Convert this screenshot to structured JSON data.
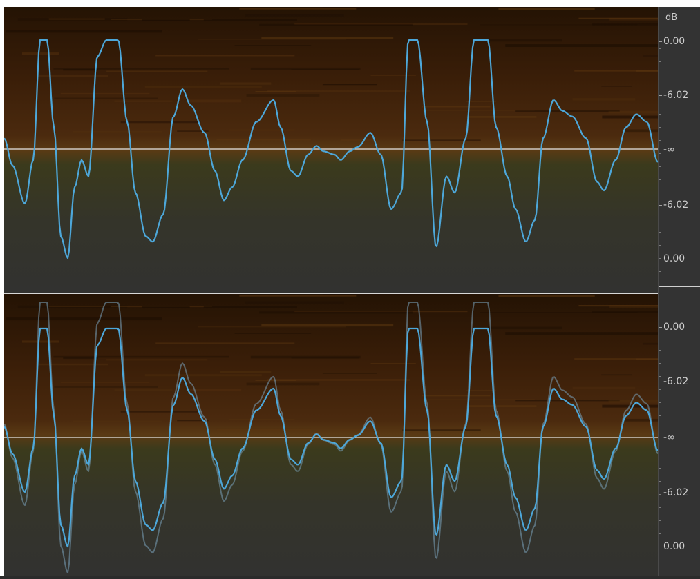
{
  "window": {
    "title": ""
  },
  "ruler": {
    "unit": "dB",
    "top_labels": [
      "0.00",
      "-6.02",
      "-∞",
      "-6.02",
      "0.00"
    ],
    "bottom_labels": [
      "0.00",
      "-6.02",
      "-∞",
      "-6.02",
      "0.00"
    ]
  },
  "channels": [
    {
      "name": "",
      "color": "#4da7d9",
      "gain": 1.0,
      "ghost": false
    },
    {
      "name": "",
      "color": "#4da7d9",
      "gain": 0.85,
      "ghost": true
    }
  ],
  "colors": {
    "spectrogram_top": "#2b1606",
    "spectrogram_mid": "#4a2a10",
    "spectrogram_low": "#3a3a20",
    "background": "#2b2b2b",
    "waveform": "#4da7d9",
    "centerline": "#e6e6e6"
  }
}
